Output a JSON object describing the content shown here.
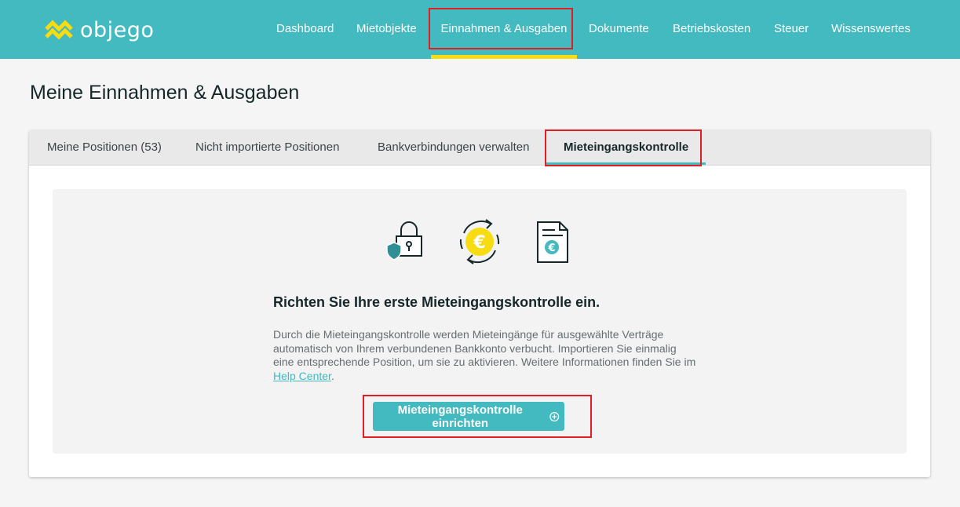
{
  "header": {
    "logo_text": "objego",
    "nav": [
      {
        "label": "Dashboard"
      },
      {
        "label": "Mietobjekte"
      },
      {
        "label": "Einnahmen & Ausgaben",
        "active": true
      },
      {
        "label": "Dokumente"
      },
      {
        "label": "Betriebskosten"
      },
      {
        "label": "Steuer"
      },
      {
        "label": "Wissenswertes"
      }
    ]
  },
  "page": {
    "title": "Meine Einnahmen & Ausgaben"
  },
  "tabs": [
    {
      "label": "Meine Positionen (53)"
    },
    {
      "label": "Nicht importierte Positionen"
    },
    {
      "label": "Bankverbindungen verwalten"
    },
    {
      "label": "Mieteingangskontrolle",
      "active": true
    }
  ],
  "empty_state": {
    "icons": [
      "lock-shield-icon",
      "euro-coin-cycle-icon",
      "euro-document-icon"
    ],
    "title": "Richten Sie Ihre erste Mieteingangskontrolle ein.",
    "text_before_link": "Durch die Mieteingangskontrolle werden Mieteingänge für ausgewählte Verträge automatisch von Ihrem verbundenen Bankkonto verbucht. Importieren Sie einmalig eine entsprechende Position, um sie zu aktivieren. Weitere Informationen finden Sie im ",
    "link_text": "Help Center",
    "text_after_link": ".",
    "button_label": "Mieteingangskontrolle einrichten",
    "button_icon": "plus-circle-icon"
  },
  "colors": {
    "brand_teal": "#43b9c0",
    "accent_yellow": "#f7dc12",
    "highlight_red": "#e01e24"
  }
}
